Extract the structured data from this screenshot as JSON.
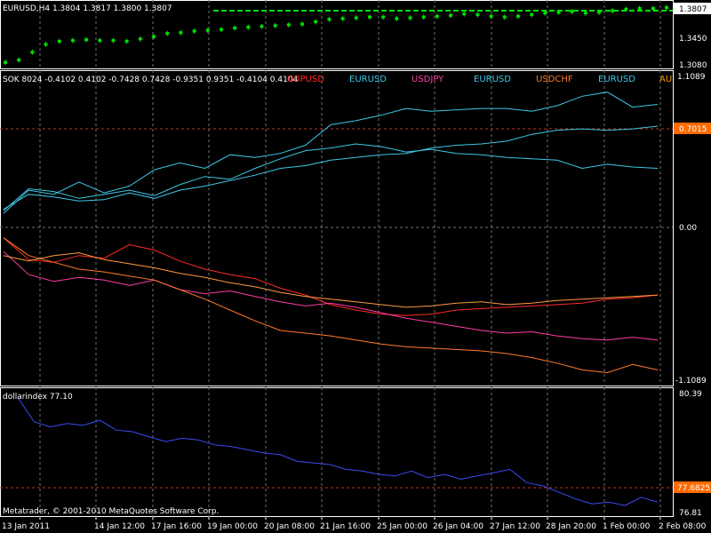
{
  "colors": {
    "background": "#000000",
    "grid": "#6f6f6f",
    "candle_up": "#00e000",
    "candle_down": "#00e000",
    "sok_lines": "#3cc8e8",
    "gbpusd": "#ff2a2a",
    "usdjpy": "#ff3ca8",
    "usdchf": "#ff7a2a",
    "dollarindex": "#3a4cf0",
    "ref_red": "#c03020",
    "highlight_label": "#ff6a00"
  },
  "panel1": {
    "title": "EURUSD,H4 1.3804 1.3817 1.3800 1.3807",
    "price_top": "1.3807",
    "price_mid": "1.3450",
    "price_bottom": "1.3080"
  },
  "panel2": {
    "indicator_text": "SOK 8024 -0.4102 0.4102 -0.7428 0.7428 -0.9351 0.9351 -0.4104 0.4104",
    "legend": [
      {
        "label": "GBPUSD",
        "color": "#ff2a2a"
      },
      {
        "label": "EURUSD",
        "color": "#3cc8e8"
      },
      {
        "label": "USDJPY",
        "color": "#ff3ca8"
      },
      {
        "label": "EURUSD",
        "color": "#3cc8e8"
      },
      {
        "label": "USDCHF",
        "color": "#ff7a2a"
      },
      {
        "label": "EURUSD",
        "color": "#3cc8e8"
      },
      {
        "label": "AU",
        "color": "#ff9a00"
      }
    ],
    "scale_top": "1.1089",
    "scale_ref": "0.7015",
    "scale_zero": "0.00",
    "scale_bottom": "-1.1089"
  },
  "panel3": {
    "title": "dollarindex 77.10",
    "scale_top": "80.39",
    "scale_ref": "77.6825",
    "scale_bottom": "76.81",
    "copyright": "Metatrader, © 2001-2010 MetaQuotes Software Corp."
  },
  "xaxis": {
    "labels": [
      "13 Jan 2011",
      "14 Jan 12:00",
      "17 Jan 16:00",
      "19 Jan 00:00",
      "20 Jan 08:00",
      "21 Jan 16:00",
      "25 Jan 00:00",
      "26 Jan 04:00",
      "27 Jan 12:00",
      "28 Jan 20:00",
      "1 Feb 00:00",
      "2 Feb 08:00"
    ]
  },
  "chart_data": [
    {
      "type": "line",
      "title": "EURUSD,H4 1.3804 1.3817 1.3800 1.3807",
      "ylim": [
        1.308,
        1.3807
      ],
      "ticks": [
        1.3807,
        1.345,
        1.308
      ],
      "series": [
        {
          "name": "EURUSD,H4",
          "values": [
            1.31,
            1.313,
            1.323,
            1.333,
            1.337,
            1.338,
            1.339,
            1.338,
            1.338,
            1.337,
            1.34,
            1.343,
            1.347,
            1.348,
            1.35,
            1.351,
            1.352,
            1.354,
            1.355,
            1.356,
            1.357,
            1.358,
            1.359,
            1.362,
            1.365,
            1.366,
            1.367,
            1.368,
            1.368,
            1.366,
            1.367,
            1.368,
            1.369,
            1.37,
            1.372,
            1.371,
            1.369,
            1.368,
            1.369,
            1.371,
            1.373,
            1.374,
            1.375,
            1.373,
            1.374,
            1.376,
            1.378,
            1.379,
            1.379,
            1.38
          ]
        }
      ]
    },
    {
      "type": "line",
      "title": "SOK 8024 -0.4102 0.4102 -0.7428 0.7428 -0.9351 0.9351 -0.4104 0.4104",
      "ylim": [
        -1.1089,
        1.1089
      ],
      "ticks": [
        1.1089,
        0.7015,
        0.0,
        -1.1089
      ],
      "series": [
        {
          "name": "EURUSD",
          "values": [
            0.11,
            0.28,
            0.25,
            0.34,
            0.26,
            0.31,
            0.43,
            0.48,
            0.44,
            0.54,
            0.52,
            0.55,
            0.61,
            0.76,
            0.79,
            0.83,
            0.88,
            0.86,
            0.87,
            0.88,
            0.88,
            0.86,
            0.9,
            0.97,
            1.0,
            0.89,
            0.91
          ]
        },
        {
          "name": "EURUSD",
          "values": [
            0.13,
            0.29,
            0.27,
            0.22,
            0.25,
            0.28,
            0.24,
            0.32,
            0.38,
            0.36,
            0.44,
            0.51,
            0.57,
            0.59,
            0.62,
            0.6,
            0.56,
            0.58,
            0.55,
            0.54,
            0.52,
            0.51,
            0.5,
            0.44,
            0.47,
            0.45,
            0.44
          ]
        },
        {
          "name": "EURUSD",
          "values": [
            0.14,
            0.25,
            0.23,
            0.2,
            0.21,
            0.26,
            0.22,
            0.28,
            0.31,
            0.35,
            0.39,
            0.44,
            0.46,
            0.5,
            0.52,
            0.54,
            0.55,
            0.59,
            0.61,
            0.62,
            0.64,
            0.69,
            0.72,
            0.73,
            0.72,
            0.73,
            0.75
          ]
        },
        {
          "name": "GBPUSD",
          "values": [
            -0.07,
            -0.23,
            -0.25,
            -0.2,
            -0.22,
            -0.12,
            -0.16,
            -0.24,
            -0.3,
            -0.34,
            -0.37,
            -0.44,
            -0.49,
            -0.56,
            -0.6,
            -0.63,
            -0.64,
            -0.63,
            -0.6,
            -0.59,
            -0.58,
            -0.57,
            -0.56,
            -0.55,
            -0.52,
            -0.51,
            -0.49
          ]
        },
        {
          "name": "USDJPY",
          "values": [
            -0.17,
            -0.34,
            -0.39,
            -0.36,
            -0.38,
            -0.42,
            -0.38,
            -0.45,
            -0.48,
            -0.46,
            -0.5,
            -0.54,
            -0.57,
            -0.55,
            -0.58,
            -0.62,
            -0.66,
            -0.69,
            -0.72,
            -0.75,
            -0.77,
            -0.76,
            -0.79,
            -0.81,
            -0.82,
            -0.8,
            -0.82
          ]
        },
        {
          "name": "USDCHF",
          "values": [
            -0.07,
            -0.2,
            -0.25,
            -0.3,
            -0.32,
            -0.35,
            -0.38,
            -0.45,
            -0.52,
            -0.6,
            -0.68,
            -0.75,
            -0.77,
            -0.79,
            -0.82,
            -0.85,
            -0.87,
            -0.88,
            -0.89,
            -0.9,
            -0.92,
            -0.95,
            -0.99,
            -1.04,
            -1.06,
            -1.0,
            -1.04
          ]
        },
        {
          "name": "AU",
          "values": [
            -0.2,
            -0.24,
            -0.2,
            -0.18,
            -0.23,
            -0.26,
            -0.29,
            -0.33,
            -0.36,
            -0.4,
            -0.43,
            -0.47,
            -0.5,
            -0.52,
            -0.54,
            -0.56,
            -0.58,
            -0.57,
            -0.55,
            -0.54,
            -0.56,
            -0.55,
            -0.53,
            -0.52,
            -0.51,
            -0.5,
            -0.49
          ]
        }
      ]
    },
    {
      "type": "line",
      "title": "dollarindex 77.10",
      "ylim": [
        76.81,
        80.39
      ],
      "ticks": [
        80.39,
        77.6825,
        76.81
      ],
      "series": [
        {
          "name": "dollarindex",
          "values": [
            80.3,
            79.55,
            79.4,
            79.5,
            79.45,
            79.6,
            79.3,
            79.25,
            79.1,
            78.95,
            79.05,
            79.0,
            78.85,
            78.8,
            78.7,
            78.6,
            78.55,
            78.35,
            78.3,
            78.25,
            78.1,
            78.05,
            77.95,
            77.9,
            78.05,
            77.85,
            77.95,
            77.8,
            77.9,
            78.0,
            78.1,
            77.7,
            77.6,
            77.4,
            77.2,
            77.05,
            77.1,
            77.0,
            77.25,
            77.1
          ]
        }
      ]
    }
  ]
}
